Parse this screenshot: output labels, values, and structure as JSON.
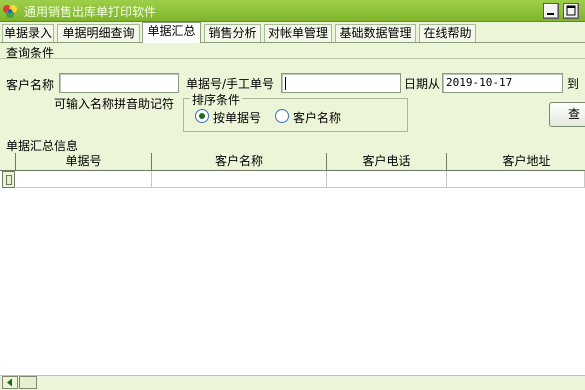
{
  "window": {
    "title": "通用销售出库单打印软件",
    "icon": "app-logo-icon"
  },
  "tabs": [
    {
      "label": "单据录入",
      "active": false
    },
    {
      "label": "单据明细查询",
      "active": false
    },
    {
      "label": "单据汇总",
      "active": true
    },
    {
      "label": "销售分析",
      "active": false
    },
    {
      "label": "对帐单管理",
      "active": false
    },
    {
      "label": "基础数据管理",
      "active": false
    },
    {
      "label": "在线帮助",
      "active": false
    }
  ],
  "query": {
    "section_title": "查询条件",
    "customer_label": "客户名称",
    "customer_value": "",
    "customer_hint": "可输入名称拼音助记符",
    "doc_no_label": "单据号/手工单号",
    "doc_no_value": "",
    "date_from_label": "日期从",
    "date_from_value": "2019-10-17",
    "date_to_label": "到",
    "search_button": "查",
    "sort": {
      "title": "排序条件",
      "options": [
        {
          "label": "按单据号",
          "selected": true
        },
        {
          "label": "客户名称",
          "selected": false
        }
      ]
    }
  },
  "results": {
    "section_title": "单据汇总信息",
    "columns": [
      "单据号",
      "客户名称",
      "客户电话",
      "客户地址"
    ],
    "rows": []
  },
  "colors": {
    "title_bar": "#8fc23a",
    "background": "#ecf5d8",
    "radio_dot": "#1d6a1d"
  }
}
